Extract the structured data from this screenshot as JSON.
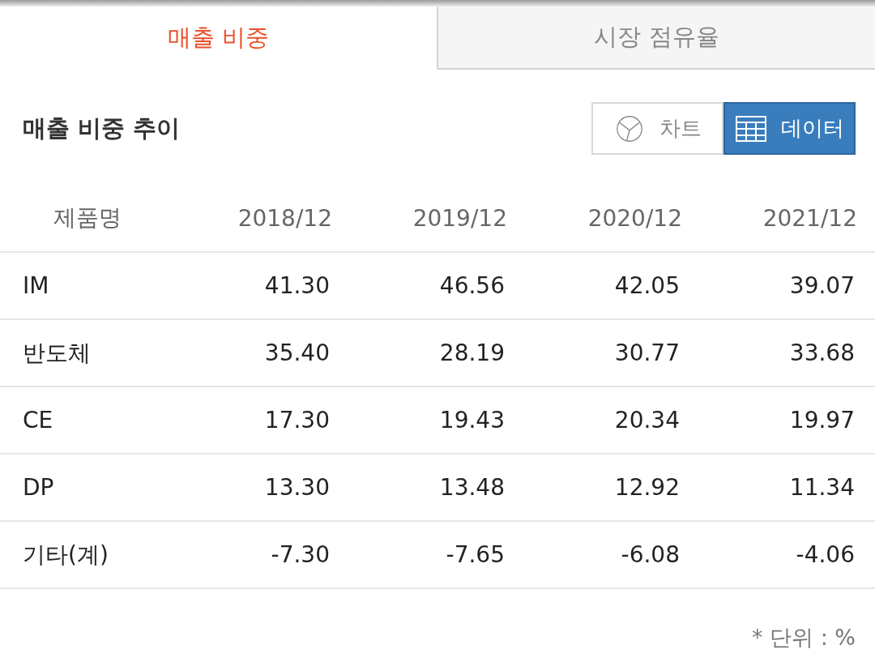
{
  "tabs": [
    {
      "label": "매출 비중",
      "selected": true
    },
    {
      "label": "시장 점유율",
      "selected": false
    }
  ],
  "section_title": "매출 비중 추이",
  "view_toggle": [
    {
      "label": "차트",
      "kind": "chart",
      "selected": false
    },
    {
      "label": "데이터",
      "kind": "table",
      "selected": true
    }
  ],
  "table": {
    "columns": [
      "제품명",
      "2018/12",
      "2019/12",
      "2020/12",
      "2021/12"
    ],
    "rows": [
      [
        "IM",
        "41.30",
        "46.56",
        "42.05",
        "39.07"
      ],
      [
        "반도체",
        "35.40",
        "28.19",
        "30.77",
        "33.68"
      ],
      [
        "CE",
        "17.30",
        "19.43",
        "20.34",
        "19.97"
      ],
      [
        "DP",
        "13.30",
        "13.48",
        "12.92",
        "11.34"
      ],
      [
        "기타(계)",
        "-7.30",
        "-7.65",
        "-6.08",
        "-4.06"
      ]
    ]
  },
  "unit_note": "* 단위 : %"
}
